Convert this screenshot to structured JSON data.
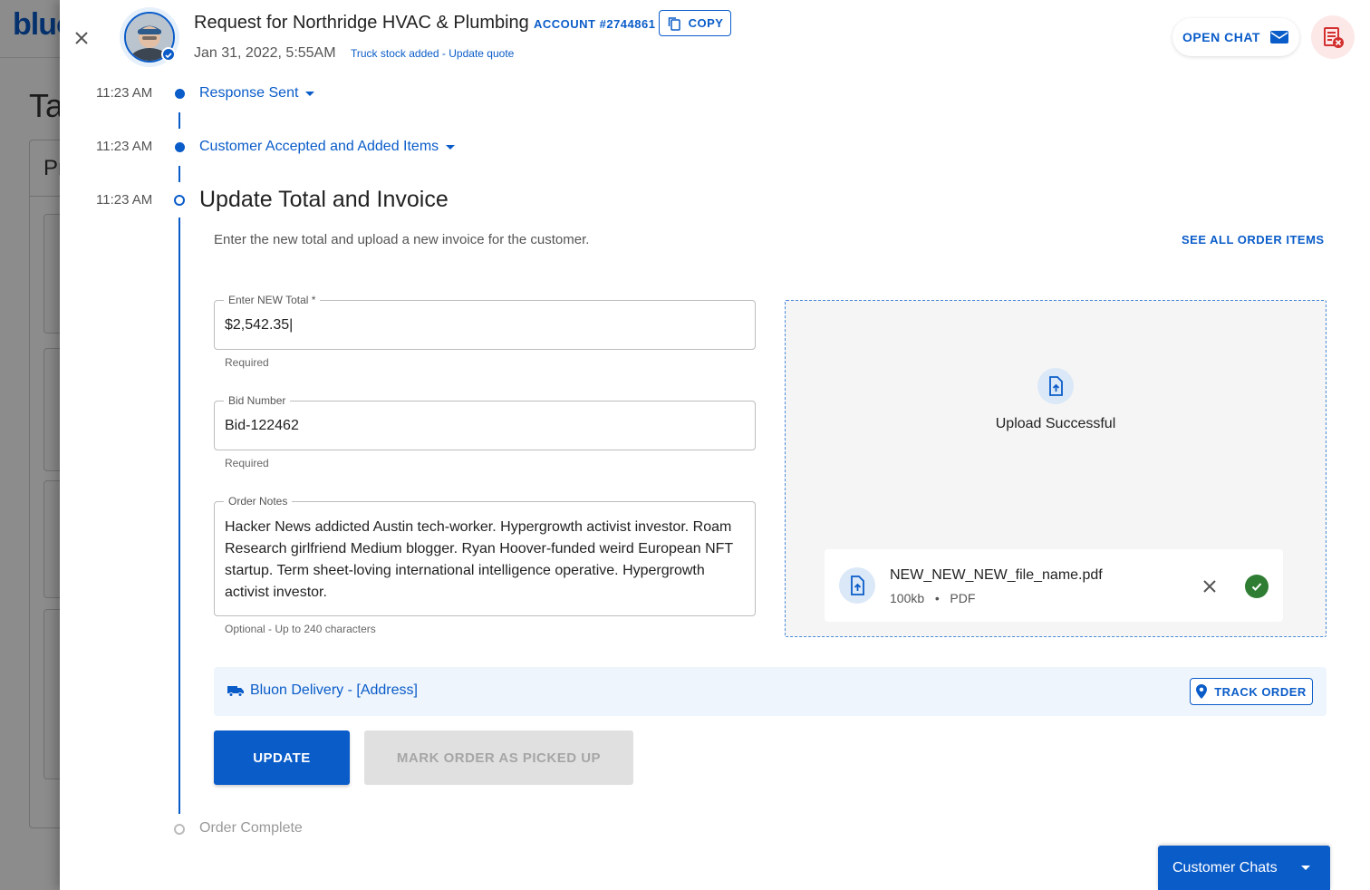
{
  "background": {
    "logo": "bluon",
    "heading": "Ta",
    "card_label": "Pr"
  },
  "header": {
    "title": "Request for Northridge HVAC & Plumbing",
    "account": "ACCOUNT #2744861",
    "copy_label": "COPY",
    "date": "Jan 31, 2022, 5:55AM",
    "stock_link": "Truck stock added - Update quote",
    "open_chat_label": "OPEN CHAT"
  },
  "timeline": {
    "events": [
      {
        "time": "11:23 AM",
        "label": "Response Sent"
      },
      {
        "time": "11:23 AM",
        "label": "Customer Accepted and Added Items"
      },
      {
        "time": "11:23 AM",
        "label": "Update Total and Invoice"
      }
    ],
    "final_step": "Order Complete"
  },
  "form": {
    "instruction": "Enter the new total and upload a new invoice for the customer.",
    "see_all_label": "SEE ALL ORDER ITEMS",
    "total": {
      "label": "Enter NEW Total *",
      "value": "$2,542.35|",
      "help": "Required"
    },
    "bid": {
      "label": "Bid Number",
      "value": "Bid-122462",
      "help": "Required"
    },
    "notes": {
      "label": "Order Notes",
      "value": "Hacker News addicted Austin tech-worker. Hypergrowth activist investor. Roam Research girlfriend Medium blogger. Ryan Hoover-funded weird European NFT startup. Term sheet-loving international intelligence operative. Hypergrowth activist investor.",
      "help": "Optional - Up to 240 characters"
    }
  },
  "upload": {
    "status": "Upload Successful",
    "file_name": "NEW_NEW_NEW_file_name.pdf",
    "file_size": "100kb",
    "file_type": "PDF"
  },
  "delivery": {
    "label": "Bluon Delivery - [Address]",
    "track_label": "TRACK ORDER"
  },
  "actions": {
    "update_label": "UPDATE",
    "pickup_label": "MARK ORDER AS PICKED UP"
  },
  "chats": {
    "label": "Customer Chats"
  },
  "colors": {
    "primary": "#0a5cc9",
    "success": "#2e7d32",
    "alert": "#d32f2f"
  }
}
